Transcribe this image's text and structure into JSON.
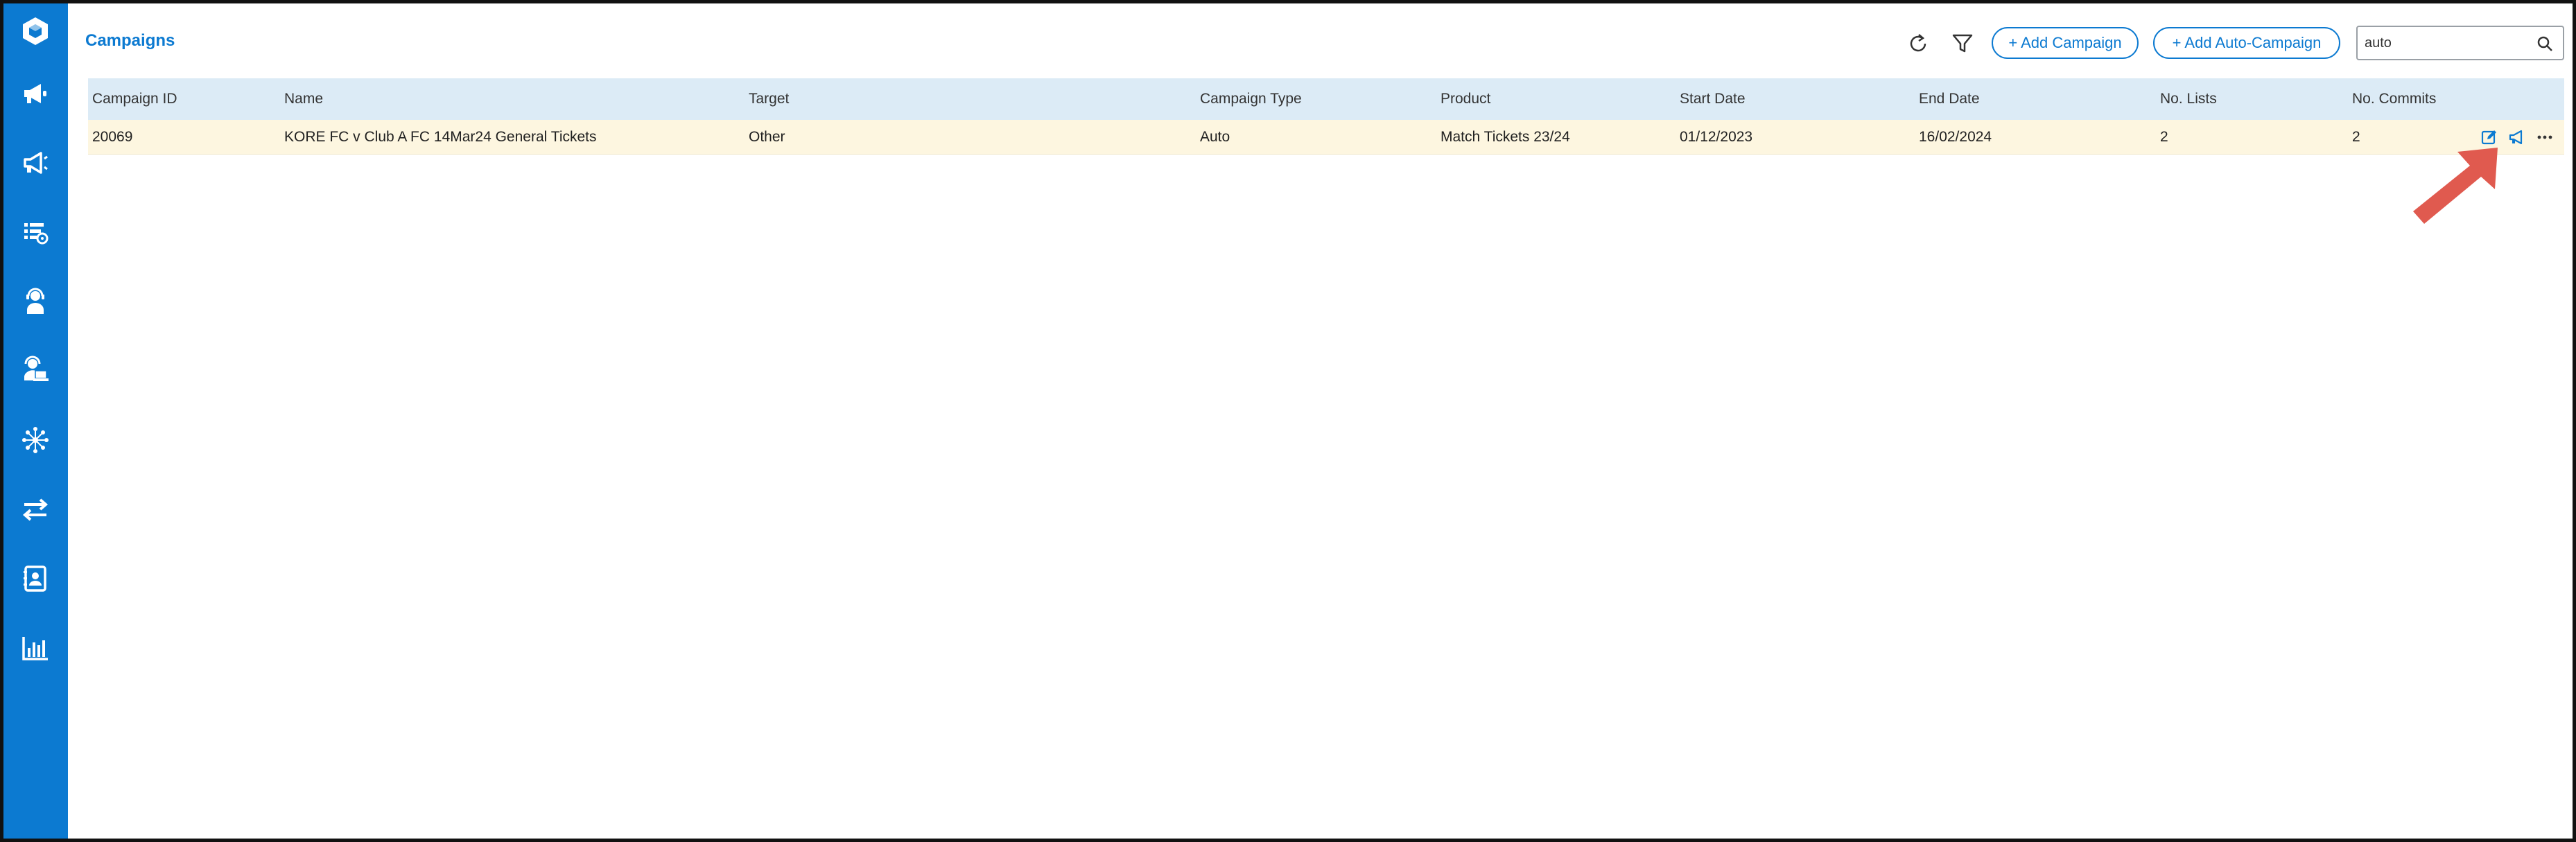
{
  "page": {
    "title": "Campaigns"
  },
  "sidebar": {
    "items": [
      {
        "name": "logo-icon"
      },
      {
        "name": "megaphone-icon"
      },
      {
        "name": "megaphone-outline-icon"
      },
      {
        "name": "list-settings-icon"
      },
      {
        "name": "agent-icon"
      },
      {
        "name": "agent-laptop-icon"
      },
      {
        "name": "network-icon"
      },
      {
        "name": "transfer-icon"
      },
      {
        "name": "contact-book-icon"
      },
      {
        "name": "bar-chart-icon"
      }
    ]
  },
  "toolbar": {
    "refresh_icon": "refresh-icon",
    "filter_icon": "filter-icon",
    "add_campaign_label": "+ Add Campaign",
    "add_auto_campaign_label": "+ Add Auto-Campaign",
    "search_value": "auto",
    "search_icon": "search-icon"
  },
  "table": {
    "columns": [
      "Campaign ID",
      "Name",
      "Target",
      "Campaign Type",
      "Product",
      "Start Date",
      "End Date",
      "No. Lists",
      "No. Commits"
    ],
    "rows": [
      {
        "campaign_id": "20069",
        "name": "KORE FC v Club A FC 14Mar24 General Tickets",
        "target": "Other",
        "campaign_type": "Auto",
        "product": "Match Tickets 23/24",
        "start_date": "01/12/2023",
        "end_date": "16/02/2024",
        "no_lists": "2",
        "no_commits": "2",
        "actions": [
          "edit-icon",
          "megaphone-icon",
          "more-icon"
        ]
      }
    ]
  },
  "colors": {
    "brand_blue": "#0c7ad1",
    "header_row": "#dcebf6",
    "highlight_row": "#fdf6e0",
    "annotation_arrow": "#e05a4f"
  }
}
